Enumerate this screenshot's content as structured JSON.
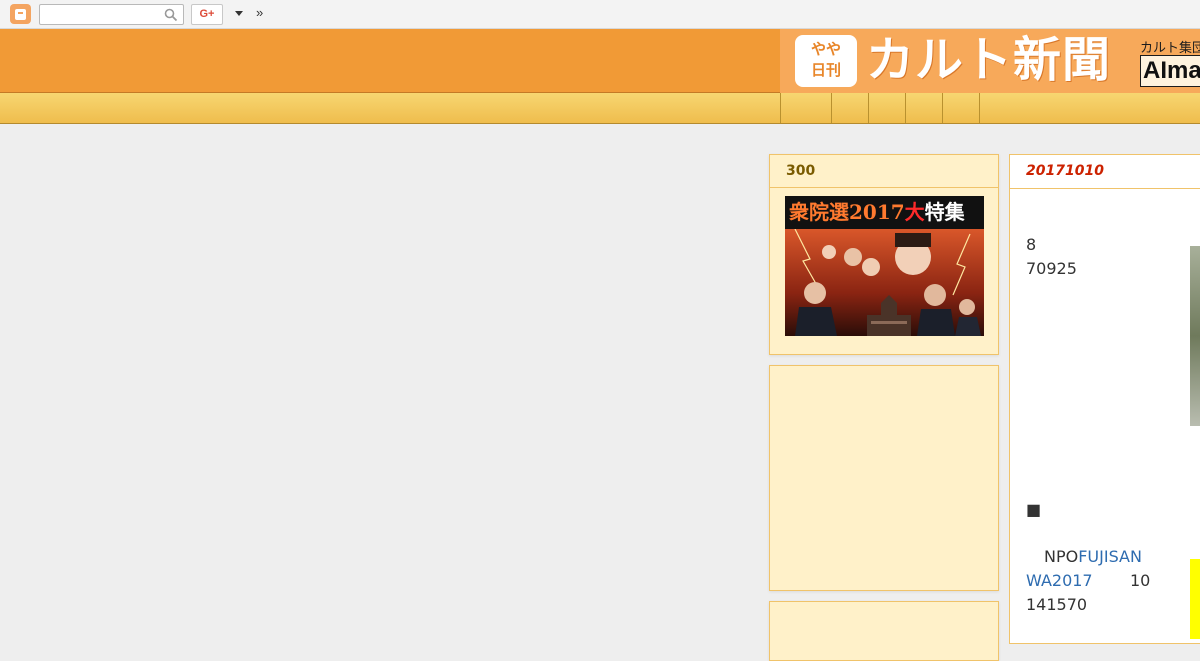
{
  "navbar": {
    "logo_icon": "blogger-icon",
    "search_placeholder": "",
    "search_value": "",
    "gplus_label": "G+",
    "more_icon": "caret-down-icon",
    "next_label": "»"
  },
  "header": {
    "badge_text": "やや\n日刊",
    "title": "カルト新聞",
    "subtitle": "カルト集団",
    "subtitle2": "AIma"
  },
  "tabs": [
    {
      "label": ""
    },
    {
      "label": ""
    },
    {
      "label": ""
    },
    {
      "label": ""
    },
    {
      "label": ""
    },
    {
      "label": ""
    }
  ],
  "sidebar": {
    "widget1": {
      "title": "300",
      "image_headline_a": "衆院選2017",
      "image_headline_b": "大",
      "image_headline_c": "特集"
    }
  },
  "post": {
    "date": "20171010",
    "line1": "8",
    "line2": "70925",
    "bullet": "■",
    "p2_prefix": "NPO",
    "p2_link_a": "FUJISAN",
    "p2_link_b": "WA2017",
    "p2_num": "10",
    "p2_line3": "141570"
  },
  "colors": {
    "header_orange": "#f19a36",
    "tab_gold": "#efbd4d",
    "widget_bg": "#fff1c9",
    "date_red": "#cc2200",
    "link_blue": "#2e6cb0"
  }
}
